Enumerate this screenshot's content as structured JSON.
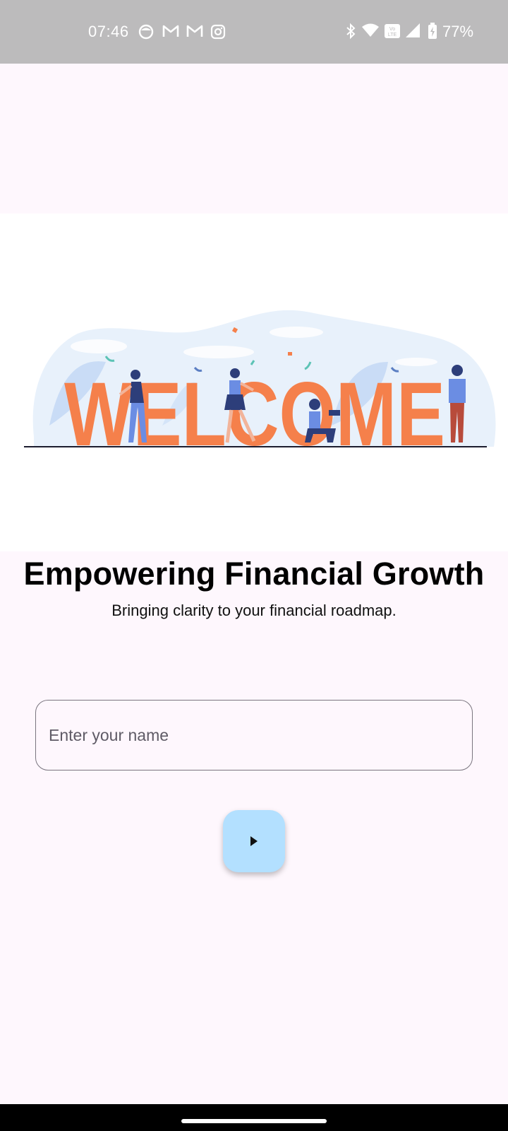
{
  "status_bar": {
    "time": "07:46",
    "battery": "77%",
    "left_icons": [
      "face-icon",
      "gmail-icon",
      "gmail-icon",
      "instagram-icon"
    ],
    "right_icons": [
      "bluetooth-icon",
      "wifi-icon",
      "volte-icon",
      "signal-icon",
      "battery-icon"
    ]
  },
  "banner": {
    "word": "WELCOME",
    "letter_color": "#f5804b",
    "blob_color": "#e8f1fb"
  },
  "hero": {
    "title": "Empowering Financial Growth",
    "subtitle": "Bringing clarity to your financial roadmap."
  },
  "form": {
    "name_placeholder": "Enter your name",
    "name_value": ""
  },
  "next_button": {
    "icon": "play-arrow-icon",
    "color": "#b3e0ff"
  }
}
